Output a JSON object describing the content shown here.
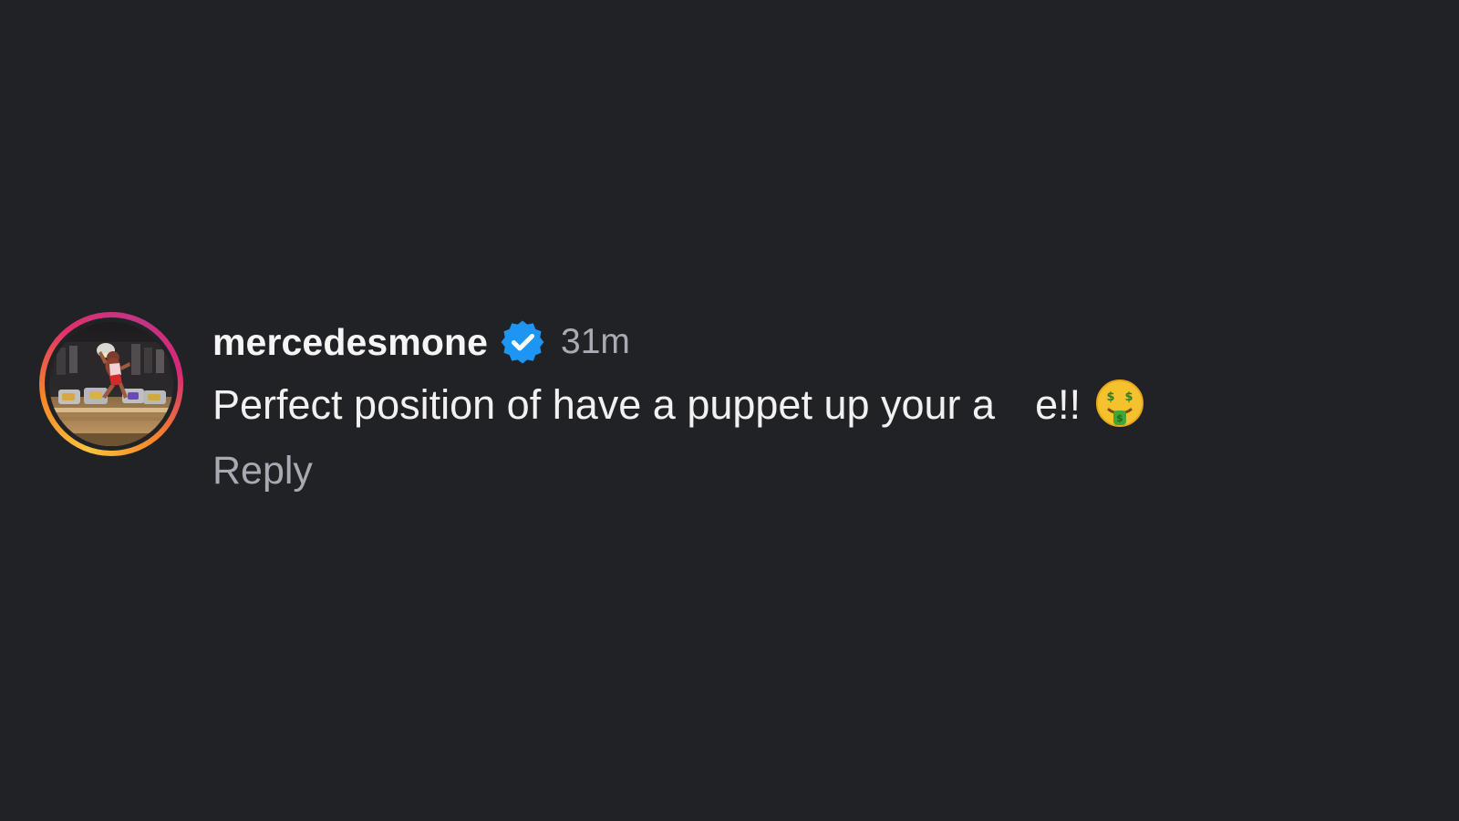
{
  "comment": {
    "username": "mercedesmone",
    "verified": true,
    "verified_icon": "verified-badge-icon",
    "timestamp": "31m",
    "text_part1": "Perfect position of have a puppet up your a",
    "text_part2": "e!!",
    "emoji": "money-mouth-face-icon",
    "reply_label": "Reply"
  },
  "colors": {
    "background": "#212226",
    "username": "#f5f5f5",
    "text": "#f1f1f2",
    "muted": "#a7aab2",
    "verified_blue": "#1c96f2"
  }
}
